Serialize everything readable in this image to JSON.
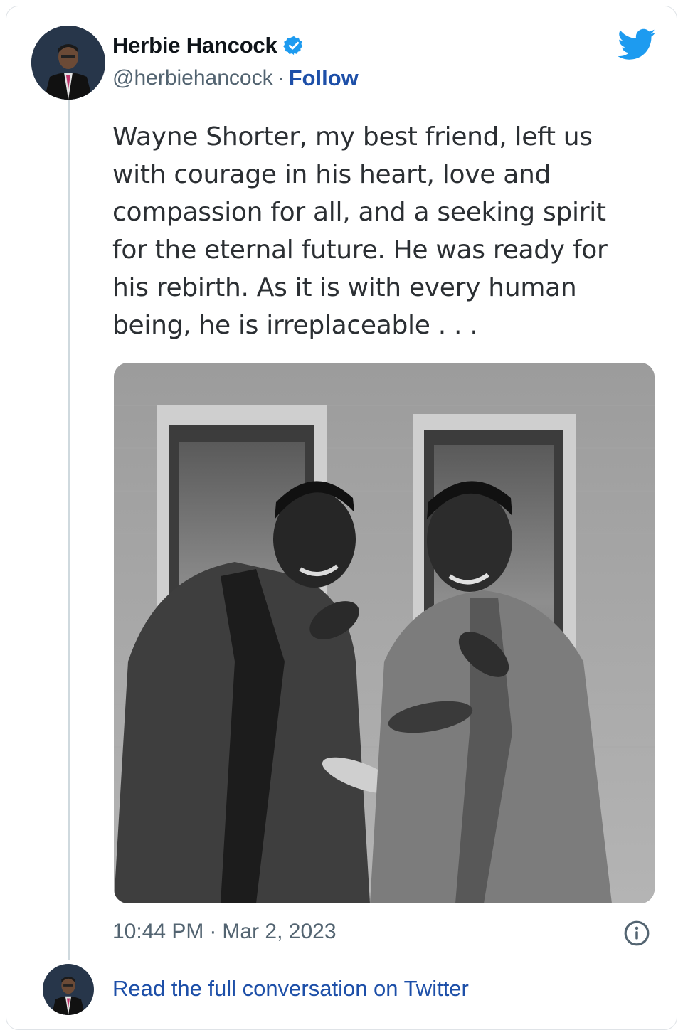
{
  "author": {
    "display_name": "Herbie Hancock",
    "handle": "@herbiehancock",
    "separator": "·",
    "follow_label": "Follow",
    "verified_icon": "verified-badge-icon"
  },
  "tweet": {
    "text_lines": [
      "Wayne Shorter, my best friend, left us",
      "with courage in his heart, love and",
      "compassion for all, and a seeking spirit",
      "for the eternal future. He was ready for",
      "his rebirth. As it is with every human",
      "being, he is irreplaceable . . ."
    ],
    "time": "10:44 PM",
    "date_separator": "·",
    "date": "Mar 2, 2023"
  },
  "footer": {
    "read_full_label": "Read the full conversation on Twitter"
  },
  "icons": {
    "brand": "twitter-bird-icon",
    "info": "info-icon"
  },
  "colors": {
    "twitter_blue": "#1d9bf0",
    "link_blue": "#1d4fa8",
    "secondary_text": "#536471"
  }
}
